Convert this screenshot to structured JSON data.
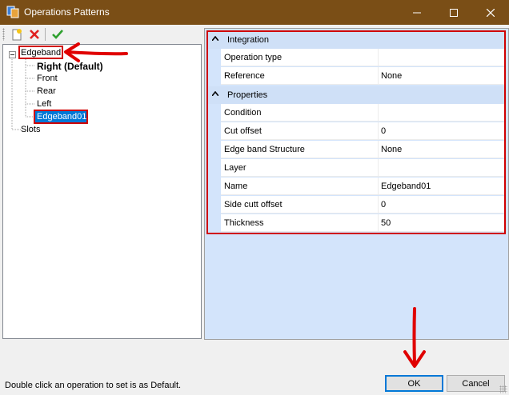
{
  "window": {
    "title": "Operations Patterns"
  },
  "tree": {
    "root_label": "Edgeband",
    "children": [
      {
        "label": "Right (Default)",
        "bold": true
      },
      {
        "label": "Front"
      },
      {
        "label": "Rear"
      },
      {
        "label": "Left"
      },
      {
        "label": "Edgeband01",
        "selected": true
      }
    ],
    "slots_label": "Slots"
  },
  "property_grid": {
    "categories": [
      {
        "label": "Integration",
        "toggle": "^",
        "rows": [
          {
            "name": "Operation type",
            "value": ""
          },
          {
            "name": "Reference",
            "value": "None"
          }
        ]
      },
      {
        "label": "Properties",
        "toggle": "^",
        "rows": [
          {
            "name": "Condition",
            "value": ""
          },
          {
            "name": "Cut offset",
            "value": "0"
          },
          {
            "name": "Edge band Structure",
            "value": "None"
          },
          {
            "name": "Layer",
            "value": ""
          },
          {
            "name": "Name",
            "value": "Edgeband01"
          },
          {
            "name": "Side cutt offset",
            "value": "0"
          },
          {
            "name": "Thickness",
            "value": "50"
          }
        ]
      }
    ]
  },
  "status_text": "Double click an operation to set is as Default.",
  "buttons": {
    "ok": "OK",
    "cancel": "Cancel"
  },
  "colors": {
    "titlebar": "#7a4e16",
    "annotation": "#d00000",
    "selection": "#0078d7"
  }
}
